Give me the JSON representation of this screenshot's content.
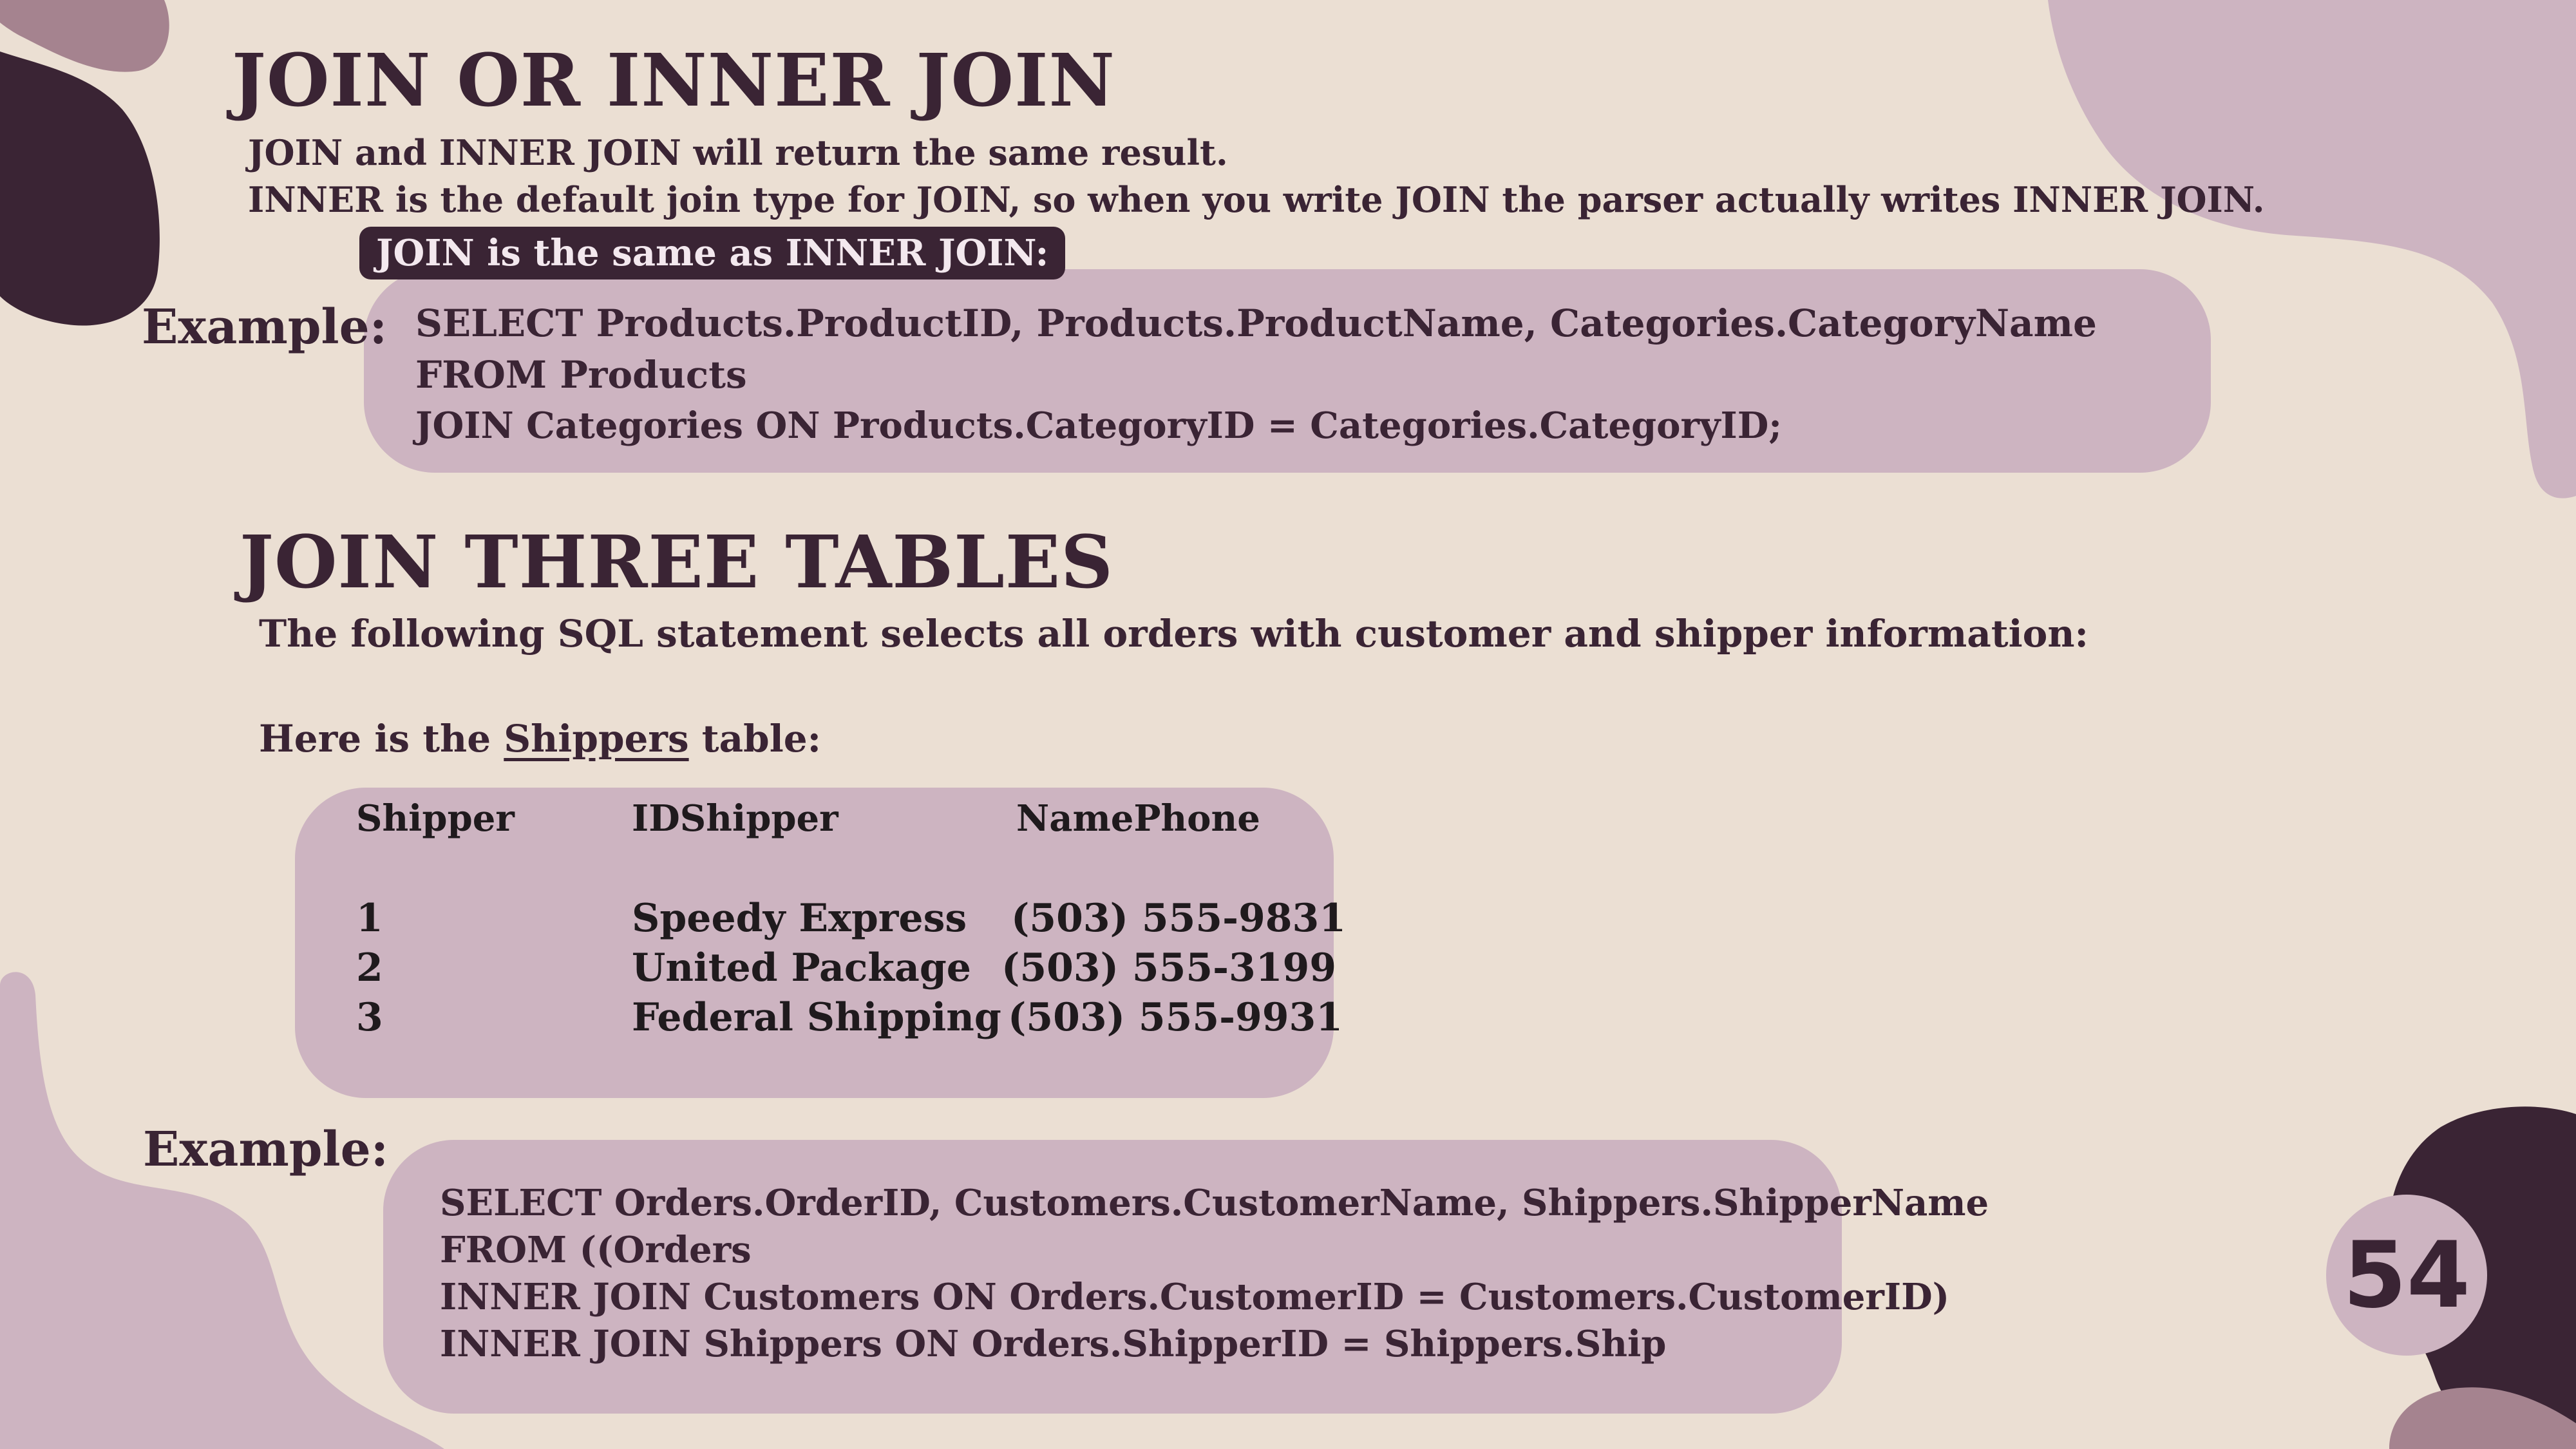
{
  "section1": {
    "title": "JOIN OR INNER JOIN",
    "line1": "JOIN and INNER JOIN will return the same result.",
    "line2": "INNER is the default join type for JOIN, so when you write JOIN the parser actually writes INNER JOIN.",
    "banner": "JOIN is the same as INNER JOIN:",
    "example_label": "Example:",
    "code": [
      "SELECT Products.ProductID, Products.ProductName, Categories.CategoryName",
      "FROM Products",
      "JOIN Categories ON Products.CategoryID = Categories.CategoryID;"
    ]
  },
  "section2": {
    "title": "JOIN THREE TABLES",
    "intro": "The following SQL statement selects all orders with customer and shipper information:",
    "table_intro_prefix": "Here is the ",
    "table_intro_link": "Shippers",
    "table_intro_suffix": " table:",
    "table": {
      "headers": [
        "Shipper",
        "IDShipper",
        "NamePhone"
      ],
      "rows": [
        [
          "1",
          "Speedy Express",
          "(503) 555-9831"
        ],
        [
          "2",
          "United Package",
          "(503) 555-3199"
        ],
        [
          "3",
          "Federal Shipping",
          "(503) 555-9931"
        ]
      ]
    },
    "example_label": "Example:",
    "code": [
      "SELECT Orders.OrderID, Customers.CustomerName, Shippers.ShipperName",
      "FROM ((Orders",
      "INNER JOIN Customers ON Orders.CustomerID = Customers.CustomerID)",
      "INNER JOIN Shippers ON Orders.ShipperID = Shippers.Ship"
    ]
  },
  "page_number": "54",
  "colors": {
    "background": "#ebdfd3",
    "dark_plum": "#3a2434",
    "mauve": "#cdb4c1",
    "dusty_mauve": "#a5838f"
  }
}
